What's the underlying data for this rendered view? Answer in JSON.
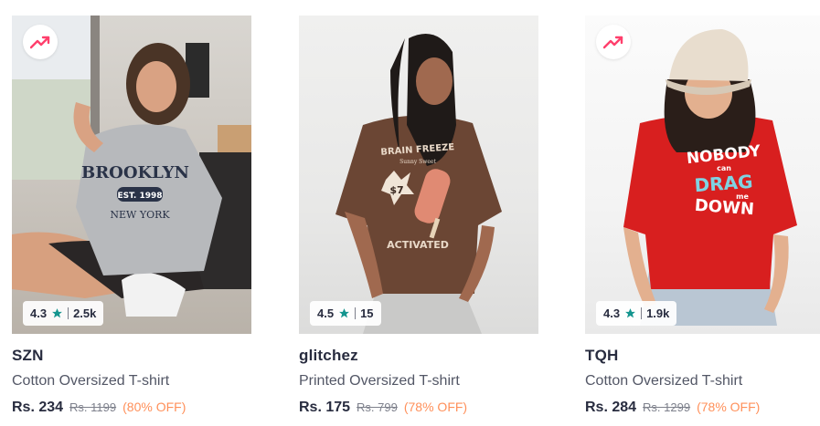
{
  "colors": {
    "accent_trend": "#ff3f6c",
    "rating_star": "#14958f",
    "discount": "#ff905a",
    "brand_text": "#282c3f",
    "muted_text": "#7e818c"
  },
  "products": [
    {
      "brand": "SZN",
      "title": "Cotton Oversized T-shirt",
      "price": "Rs. 234",
      "mrp": "Rs. 1199",
      "discount": "(80% OFF)",
      "rating": "4.3",
      "rating_count": "2.5k",
      "trending": true,
      "badge_icon": "trending-up-icon",
      "image_desc": "Grey oversized BROOKLYN EST. 1998 NEW YORK t-shirt"
    },
    {
      "brand": "glitchez",
      "title": "Printed Oversized T-shirt",
      "price": "Rs. 175",
      "mrp": "Rs. 799",
      "discount": "(78% OFF)",
      "rating": "4.5",
      "rating_count": "15",
      "trending": false,
      "image_desc": "Brown oversized t-shirt with popsicle print"
    },
    {
      "brand": "TQH",
      "title": "Cotton Oversized T-shirt",
      "price": "Rs. 284",
      "mrp": "Rs. 1299",
      "discount": "(78% OFF)",
      "rating": "4.3",
      "rating_count": "1.9k",
      "trending": true,
      "badge_icon": "trending-up-icon",
      "image_desc": "Red oversized NOBODY CAN DRAG ME DOWN t-shirt"
    }
  ]
}
